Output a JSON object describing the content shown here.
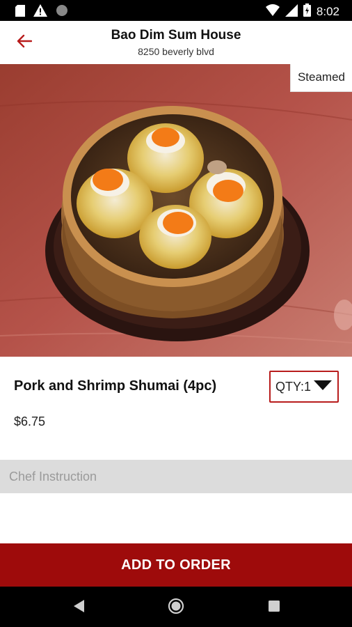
{
  "status_bar": {
    "time": "8:02",
    "left_icons": [
      "sd-card-icon",
      "warning-icon",
      "circle-icon"
    ],
    "right_icons": [
      "wifi-icon",
      "signal-icon",
      "battery-icon"
    ]
  },
  "header": {
    "title": "Bao Dim Sum House",
    "address": "8250 beverly blvd",
    "back_icon": "arrow-left-icon"
  },
  "hero": {
    "category_tag": "Steamed"
  },
  "item": {
    "name": "Pork and Shrimp Shumai (4pc)",
    "price": "$6.75",
    "qty_label": "QTY:1"
  },
  "chef_instruction": {
    "placeholder": "Chef Instruction",
    "value": ""
  },
  "add_button": {
    "label": "ADD TO ORDER"
  },
  "nav_bar": {
    "icons": [
      "back-triangle-icon",
      "home-circle-icon",
      "recents-square-icon"
    ]
  },
  "colors": {
    "accent": "#b81c1c",
    "button_bg": "#9e0b0b",
    "input_bg": "#dcdcdc"
  }
}
